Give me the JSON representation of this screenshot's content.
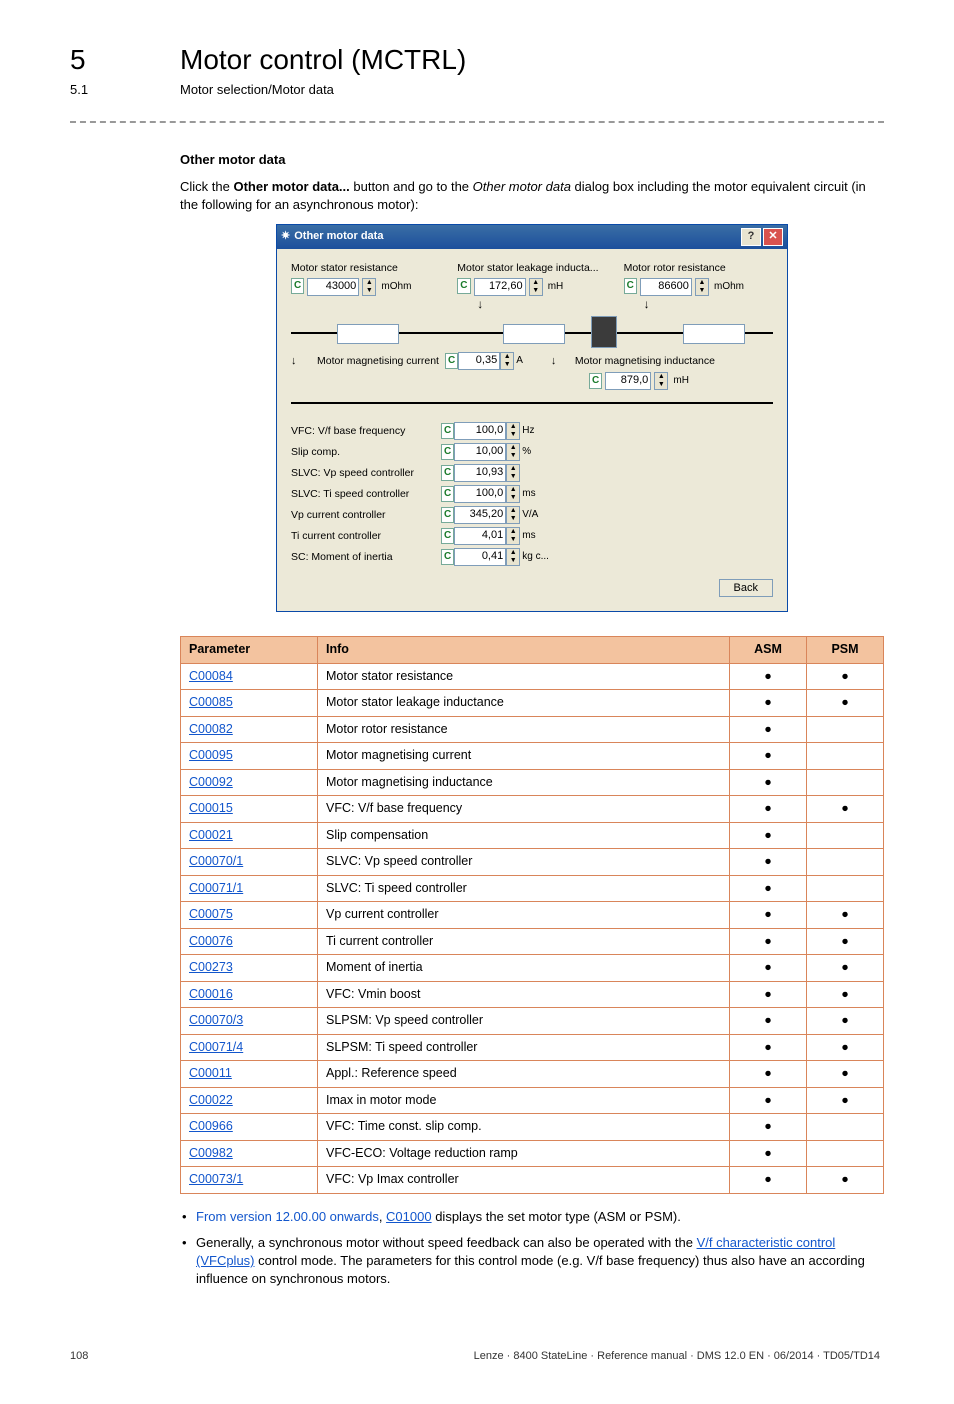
{
  "chapter": {
    "num": "5",
    "title": "Motor control (MCTRL)"
  },
  "section": {
    "num": "5.1",
    "title": "Motor selection/Motor data"
  },
  "heading": "Other motor data",
  "para1_a": "Click the ",
  "para1_bold": "Other motor data...",
  "para1_b": " button and go to the ",
  "para1_italic": "Other motor data",
  "para1_c": " dialog box including the motor equivalent circuit (in the following for an asynchronous motor):",
  "dialog": {
    "title": "Other motor data",
    "top": {
      "stator_res": {
        "label": "Motor stator resistance",
        "value": "43000",
        "unit": "mOhm"
      },
      "leakage": {
        "label": "Motor stator leakage inducta...",
        "value": "172,60",
        "unit": "mH"
      },
      "rotor_res": {
        "label": "Motor rotor resistance",
        "value": "86600",
        "unit": "mOhm"
      }
    },
    "mid": {
      "mag_current": {
        "label": "Motor magnetising current",
        "value": "0,35",
        "unit": "A"
      },
      "mag_induct": {
        "label": "Motor magnetising inductance",
        "value": "879,0",
        "unit": "mH"
      }
    },
    "params": [
      {
        "label": "VFC: V/f base frequency",
        "value": "100,0",
        "unit": "Hz"
      },
      {
        "label": "Slip comp.",
        "value": "10,00",
        "unit": "%"
      },
      {
        "label": "SLVC: Vp speed controller",
        "value": "10,93",
        "unit": ""
      },
      {
        "label": "SLVC: Ti speed controller",
        "value": "100,0",
        "unit": "ms"
      },
      {
        "label": "Vp current controller",
        "value": "345,20",
        "unit": "V/A"
      },
      {
        "label": "Ti current controller",
        "value": "4,01",
        "unit": "ms"
      },
      {
        "label": "SC: Moment of inertia",
        "value": "0,41",
        "unit": "kg c..."
      }
    ],
    "back": "Back"
  },
  "table": {
    "headers": {
      "param": "Parameter",
      "info": "Info",
      "asm": "ASM",
      "psm": "PSM"
    },
    "rows": [
      {
        "code": "C00084",
        "info": "Motor stator resistance",
        "asm": true,
        "psm": true
      },
      {
        "code": "C00085",
        "info": "Motor stator leakage inductance",
        "asm": true,
        "psm": true
      },
      {
        "code": "C00082",
        "info": "Motor rotor resistance",
        "asm": true,
        "psm": false
      },
      {
        "code": "C00095",
        "info": "Motor magnetising current",
        "asm": true,
        "psm": false
      },
      {
        "code": "C00092",
        "info": "Motor magnetising inductance",
        "asm": true,
        "psm": false
      },
      {
        "code": "C00015",
        "info": "VFC: V/f base frequency",
        "asm": true,
        "psm": true
      },
      {
        "code": "C00021",
        "info": "Slip compensation",
        "asm": true,
        "psm": false
      },
      {
        "code": "C00070/1",
        "info": "SLVC: Vp speed controller",
        "asm": true,
        "psm": false
      },
      {
        "code": "C00071/1",
        "info": "SLVC: Ti speed controller",
        "asm": true,
        "psm": false
      },
      {
        "code": "C00075",
        "info": "Vp current controller",
        "asm": true,
        "psm": true
      },
      {
        "code": "C00076",
        "info": "Ti current controller",
        "asm": true,
        "psm": true
      },
      {
        "code": "C00273",
        "info": "Moment of inertia",
        "asm": true,
        "psm": true
      },
      {
        "code": "C00016",
        "info": "VFC: Vmin boost",
        "asm": true,
        "psm": true
      },
      {
        "code": "C00070/3",
        "info": "SLPSM: Vp speed controller",
        "asm": true,
        "psm": true
      },
      {
        "code": "C00071/4",
        "info": "SLPSM: Ti speed controller",
        "asm": true,
        "psm": true
      },
      {
        "code": "C00011",
        "info": "Appl.: Reference speed",
        "asm": true,
        "psm": true
      },
      {
        "code": "C00022",
        "info": "Imax in motor mode",
        "asm": true,
        "psm": true
      },
      {
        "code": "C00966",
        "info": "VFC: Time const. slip comp.",
        "asm": true,
        "psm": false
      },
      {
        "code": "C00982",
        "info": "VFC-ECO: Voltage reduction ramp",
        "asm": true,
        "psm": false
      },
      {
        "code": "C00073/1",
        "info": "VFC: Vp Imax controller",
        "asm": true,
        "psm": true
      }
    ]
  },
  "bullets": {
    "b1_blue": "From version 12.00.00 onwards",
    "b1_mid": ", ",
    "b1_link": "C01000",
    "b1_end": " displays the set motor type (ASM or PSM).",
    "b2_a": "Generally, a synchronous motor without speed feedback can also be operated with the ",
    "b2_link": "V/f characteristic control (VFCplus)",
    "b2_b": " control mode. The parameters for this control mode (e.g. V/f base frequency) thus also have an according influence on synchronous motors."
  },
  "footer": {
    "page": "108",
    "right": "Lenze · 8400 StateLine · Reference manual · DMS 12.0 EN · 06/2014 · TD05/TD14"
  },
  "dot": "●"
}
